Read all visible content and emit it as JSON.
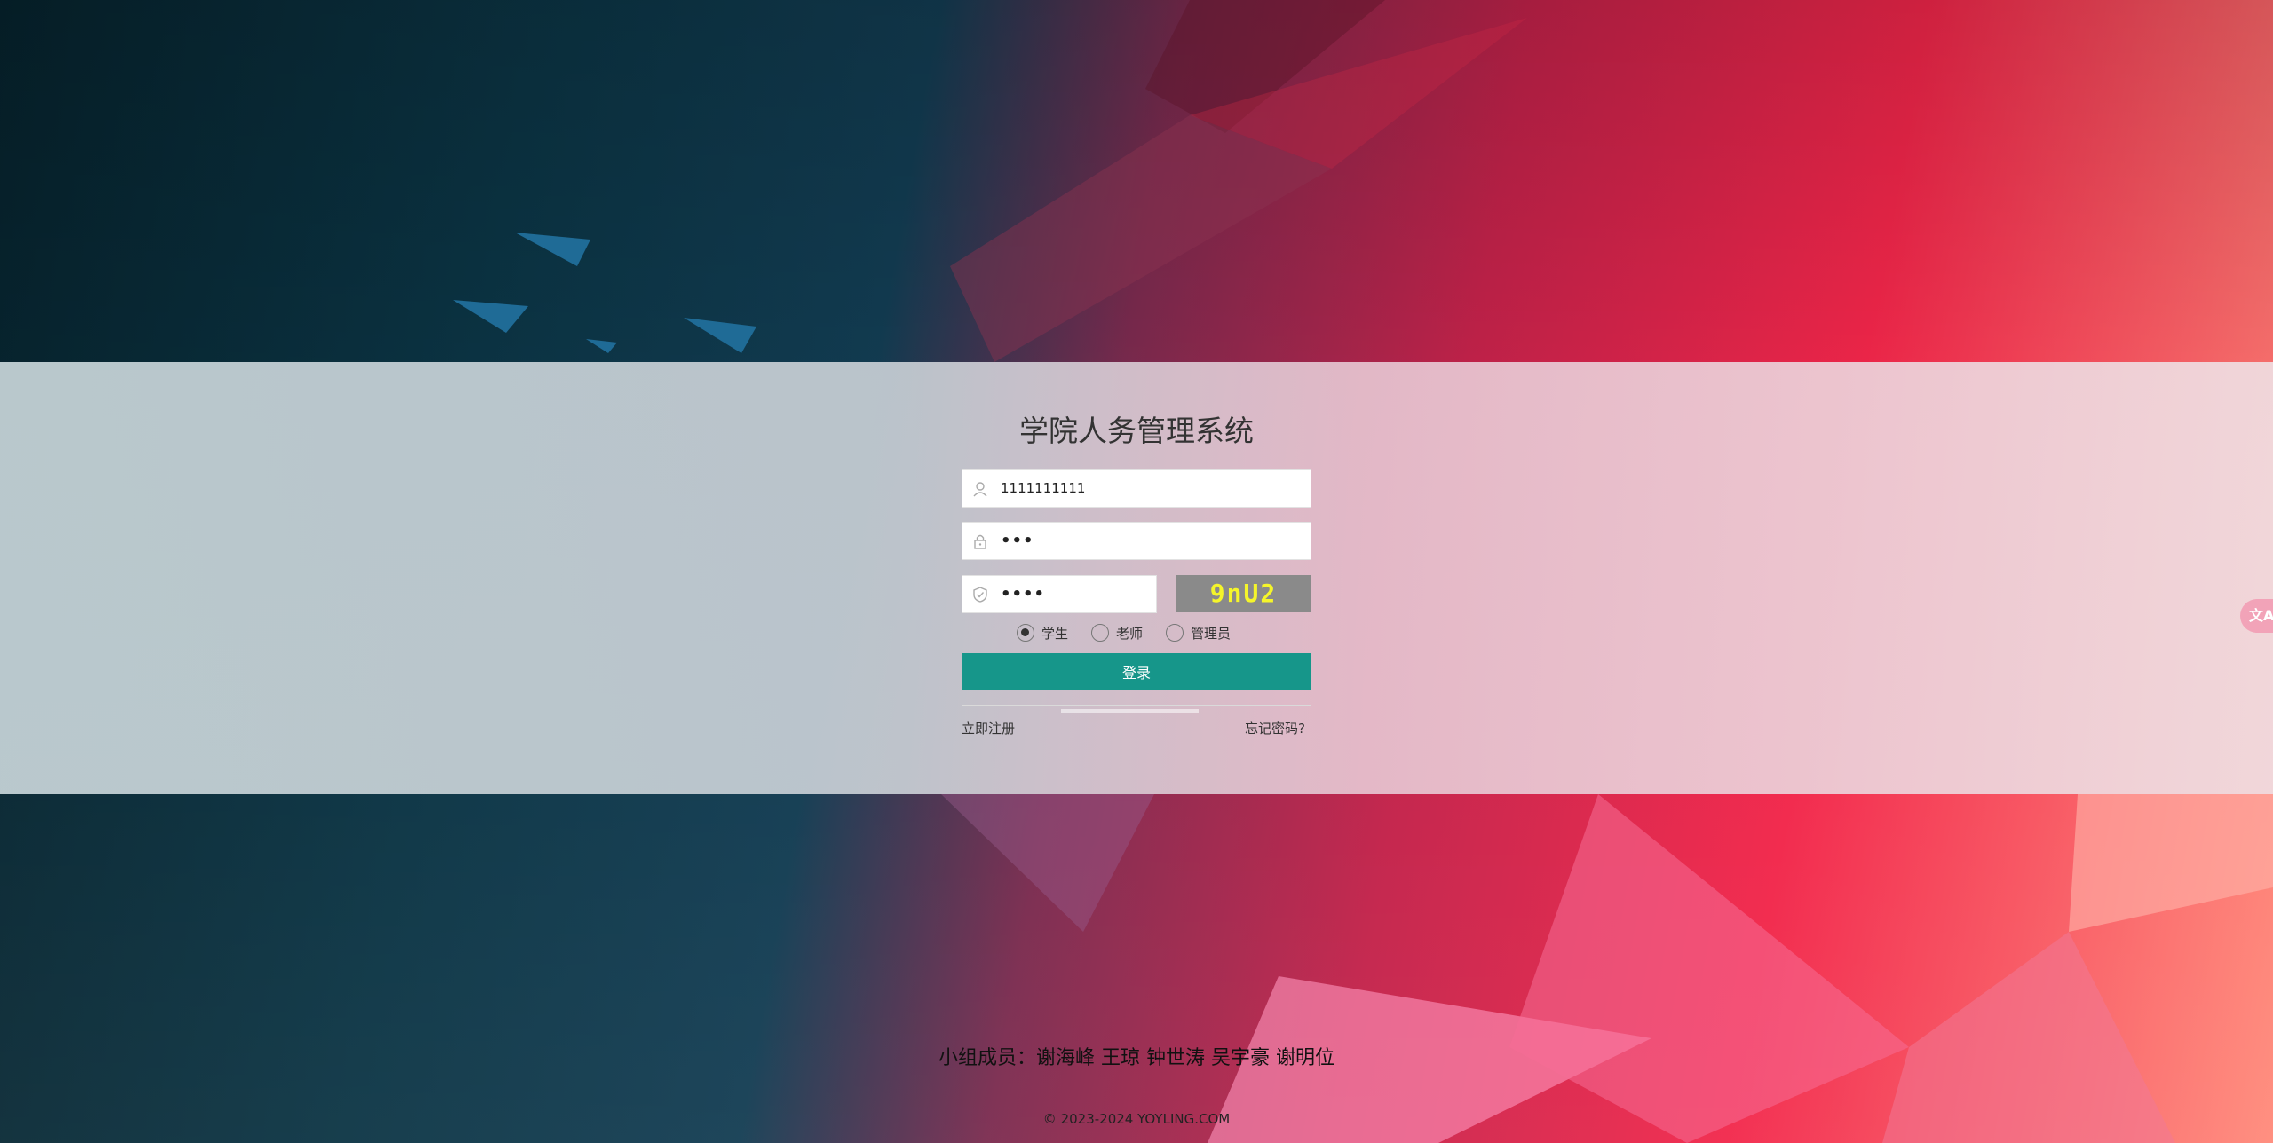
{
  "page": {
    "title": "学院人务管理系统"
  },
  "form": {
    "username_value": "1111111111",
    "password_value": "•••",
    "captcha_input_value": "••••",
    "captcha_text": "9nU2",
    "roles": [
      {
        "label": "学生",
        "selected": true
      },
      {
        "label": "老师",
        "selected": false
      },
      {
        "label": "管理员",
        "selected": false
      }
    ],
    "login_label": "登录",
    "register_label": "立即注册",
    "forgot_label": "忘记密码?"
  },
  "footer": {
    "members": "小组成员：谢海峰 王琼 钟世涛 吴宇豪 谢明位",
    "copyright": "© 2023-2024 YOYLING.COM"
  },
  "widgets": {
    "translate_glyph": "文A"
  },
  "colors": {
    "accent": "#16968a",
    "captcha_bg": "#8a8a8a",
    "captcha_text": "#f5f52a"
  },
  "icons": {
    "username": "user-icon",
    "password": "lock-icon",
    "captcha": "shield-icon",
    "translate": "translate-icon"
  }
}
